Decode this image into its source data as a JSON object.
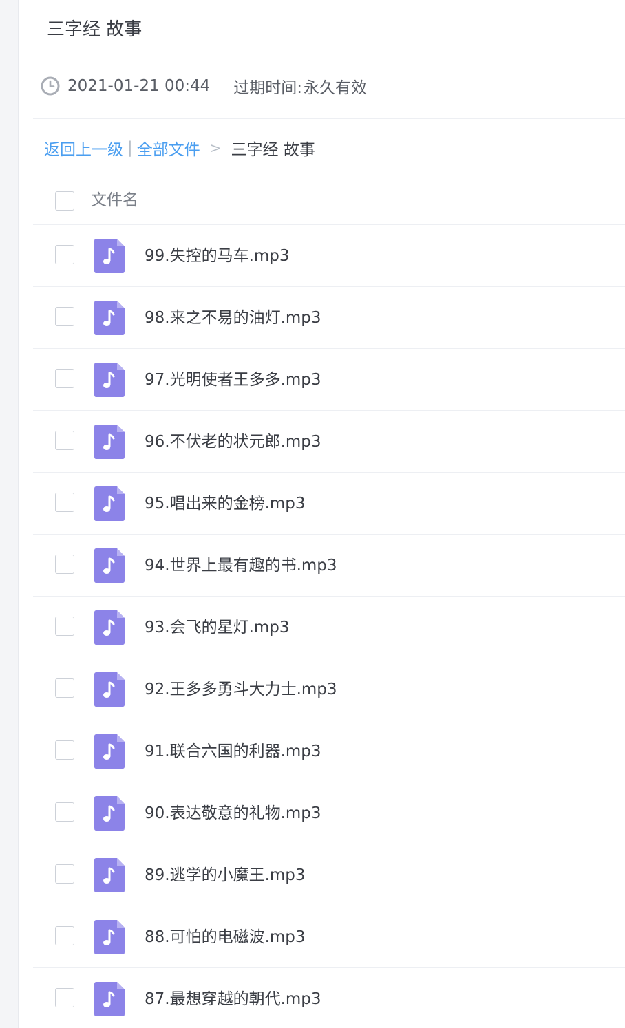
{
  "title": "三字经 故事",
  "meta": {
    "date": "2021-01-21 00:44",
    "expire_label": "过期时间:",
    "expire_value": "永久有效"
  },
  "breadcrumb": {
    "back": "返回上一级",
    "separator": "|",
    "all_files": "全部文件",
    "arrow": ">",
    "current": "三字经 故事"
  },
  "list_header": {
    "name_column": "文件名"
  },
  "files": [
    "99.失控的马车.mp3",
    "98.来之不易的油灯.mp3",
    "97.光明使者王多多.mp3",
    "96.不伏老的状元郎.mp3",
    "95.唱出来的金榜.mp3",
    "94.世界上最有趣的书.mp3",
    "93.会飞的星灯.mp3",
    "92.王多多勇斗大力士.mp3",
    "91.联合六国的利器.mp3",
    "90.表达敬意的礼物.mp3",
    "89.逃学的小魔王.mp3",
    "88.可怕的电磁波.mp3",
    "87.最想穿越的朝代.mp3"
  ],
  "icons": {
    "clock": "clock-icon",
    "file": "music-file-icon",
    "file_color": "#8c83e8"
  }
}
